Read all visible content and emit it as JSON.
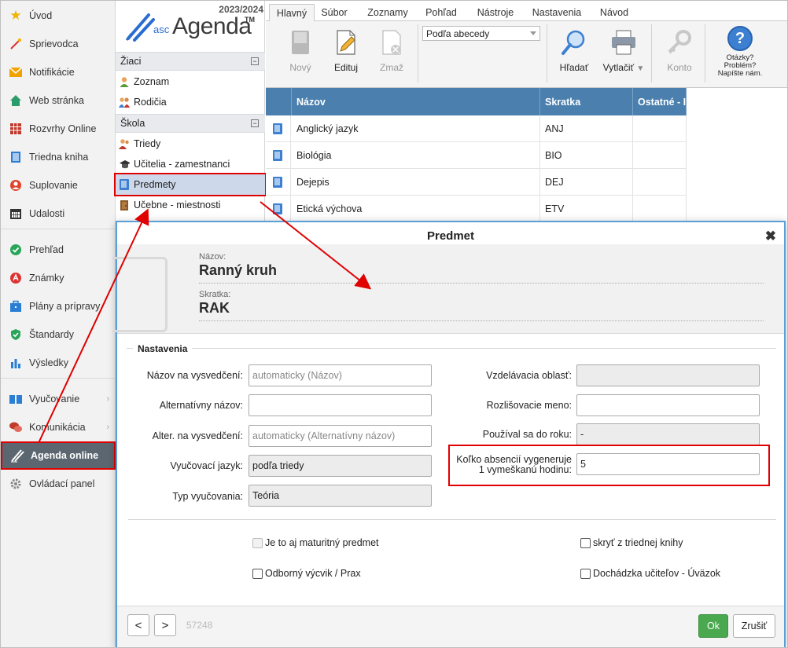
{
  "sidebar": {
    "items": [
      {
        "label": "Úvod",
        "icon": "star-icon",
        "color": "#f0b400"
      },
      {
        "label": "Sprievodca",
        "icon": "wizard-icon",
        "color": "#d33"
      },
      {
        "label": "Notifikácie",
        "icon": "envelope-icon",
        "color": "#f2a200"
      },
      {
        "label": "Web stránka",
        "icon": "home-icon",
        "color": "#2a9d6b"
      },
      {
        "label": "Rozvrhy Online",
        "icon": "grid-icon",
        "color": "#c0392b"
      },
      {
        "label": "Triedna kniha",
        "icon": "book-icon",
        "color": "#2a7fd4"
      },
      {
        "label": "Suplovanie",
        "icon": "person-icon",
        "color": "#e0452b"
      },
      {
        "label": "Udalosti",
        "icon": "calendar-icon",
        "color": "#333"
      },
      {
        "label": "Prehľad",
        "icon": "check-circle-icon",
        "color": "#29a55a"
      },
      {
        "label": "Známky",
        "icon": "grade-icon",
        "color": "#d33"
      },
      {
        "label": "Plány a prípravy",
        "icon": "briefcase-icon",
        "color": "#2a7fd4"
      },
      {
        "label": "Štandardy",
        "icon": "shield-check-icon",
        "color": "#29a55a"
      },
      {
        "label": "Výsledky",
        "icon": "bar-chart-icon",
        "color": "#2a7fd4"
      },
      {
        "label": "Vyučovanie",
        "icon": "open-book-icon",
        "color": "#2a7fd4"
      },
      {
        "label": "Komunikácia",
        "icon": "chat-icon",
        "color": "#c0392b"
      },
      {
        "label": "Agenda online",
        "icon": "pen-icon",
        "color": "#ffffff"
      },
      {
        "label": "Ovládací panel",
        "icon": "gear-icon",
        "color": "#888"
      }
    ]
  },
  "logo": {
    "year": "2023/2024",
    "asc": "asc",
    "agenda": "Agenda",
    "tm": "TM"
  },
  "nav": {
    "section1": "Žiaci",
    "section1_items": [
      "Zoznam",
      "Rodičia"
    ],
    "section2": "Škola",
    "section2_items": [
      "Triedy",
      "Učitelia - zamestnanci",
      "Predmety",
      "Učebne - miestnosti"
    ],
    "collapse": "−"
  },
  "ribbon": {
    "tabs": [
      "Hlavný",
      "Súbor",
      "Zoznamy",
      "Pohľad",
      "Nástroje",
      "Nastavenia",
      "Návod"
    ],
    "new": "Nový",
    "edit": "Edituj",
    "delete": "Zmaž",
    "sort": "Podľa abecedy",
    "search": "Hľadať",
    "print": "Vytlačiť",
    "print_arrow": "▼",
    "account": "Konto",
    "help": [
      "Otázky?",
      "Problém?",
      "Napíšte nám."
    ],
    "help_glyph": "?"
  },
  "table": {
    "headers": [
      "Názov",
      "Skratka",
      "Ostatné - I"
    ],
    "rows": [
      [
        "Anglický jazyk",
        "ANJ"
      ],
      [
        "Biológia",
        "BIO"
      ],
      [
        "Dejepis",
        "DEJ"
      ],
      [
        "Etická výchova",
        "ETV"
      ]
    ]
  },
  "dialog": {
    "title": "Predmet",
    "close": "✖",
    "name_label": "Názov:",
    "name_value": "Ranný kruh",
    "short_label": "Skratka:",
    "short_value": "RAK",
    "section": "Nastavenia",
    "left_fields": [
      {
        "label": "Názov na vysvedčení:",
        "value": "",
        "placeholder": "automaticky (Názov)"
      },
      {
        "label": "Alternatívny názov:",
        "value": "",
        "placeholder": ""
      },
      {
        "label": "Alter. na vysvedčení:",
        "value": "",
        "placeholder": "automaticky (Alternatívny názov)"
      },
      {
        "label": "Vyučovací jazyk:",
        "value": "podľa triedy",
        "placeholder": ""
      },
      {
        "label": "Typ vyučovania:",
        "value": "Teória",
        "placeholder": ""
      }
    ],
    "right_fields": [
      {
        "label": "Vzdelávacia oblasť:",
        "value": ""
      },
      {
        "label": "Rozlišovacie meno:",
        "value": ""
      },
      {
        "label": "Používal sa do roku:",
        "value": "-"
      },
      {
        "label_line1": "Koľko absencií vygeneruje",
        "label_line2": "1 vymeškanú hodinu:",
        "value": "5"
      }
    ],
    "checkboxes": [
      "Je to aj maturitný predmet",
      "Odborný výcvik / Prax",
      "skryť z triednej knihy",
      "Dochádzka učiteľov - Úväzok"
    ],
    "prev": "<",
    "next": ">",
    "record_id": "57248",
    "ok": "Ok",
    "cancel": "Zrušiť"
  },
  "colors": {
    "accent": "#4a7fae",
    "highlight": "#e00000",
    "ok": "#4aa84f",
    "active_sidebar": "#5b6670"
  }
}
